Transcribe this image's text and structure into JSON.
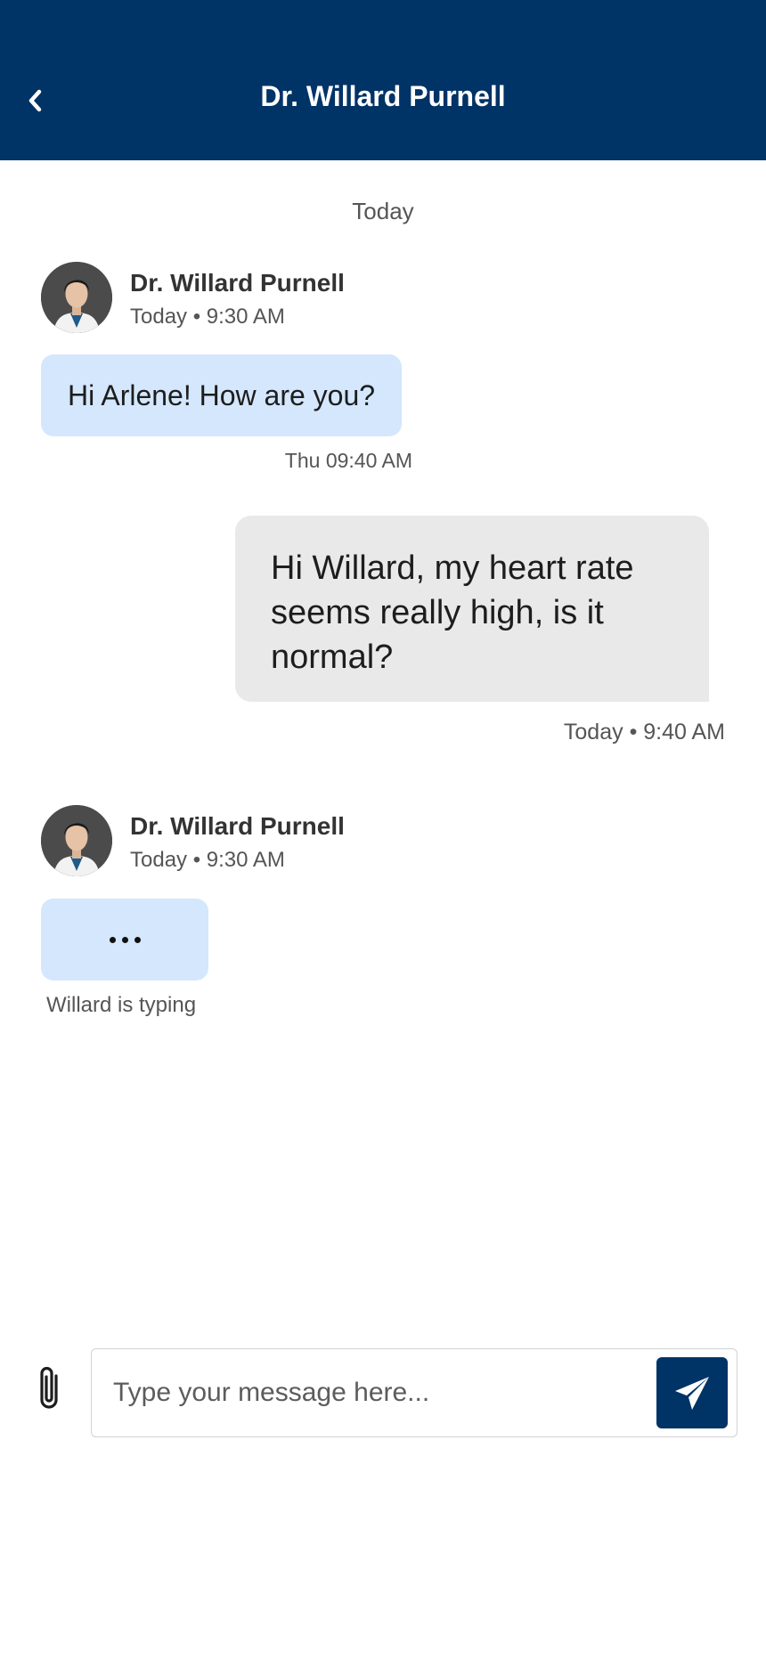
{
  "header": {
    "title": "Dr. Willard Purnell",
    "back_icon": "chevron-left-icon",
    "color": "#003366"
  },
  "conversation": {
    "date_separator": "Today",
    "messages": [
      {
        "direction": "incoming",
        "sender_name": "Dr. Willard Purnell",
        "sender_time": "Today • 9:30 AM",
        "text": "Hi Arlene! How are you?",
        "time": "Thu 09:40 AM"
      },
      {
        "direction": "outgoing",
        "text": "Hi Willard, my heart rate seems really high, is it normal?",
        "time": "Today • 9:40 AM"
      }
    ],
    "typing": {
      "sender_name": "Dr. Willard Purnell",
      "sender_time": "Today • 9:30 AM",
      "label": "Willard is typing"
    }
  },
  "composer": {
    "attach_icon": "paperclip-icon",
    "placeholder": "Type your message here...",
    "value": "",
    "send_icon": "paper-plane-icon"
  },
  "colors": {
    "brand": "#003366",
    "incoming_bubble": "#d4e7fd",
    "outgoing_bubble": "#e9e9e9"
  }
}
